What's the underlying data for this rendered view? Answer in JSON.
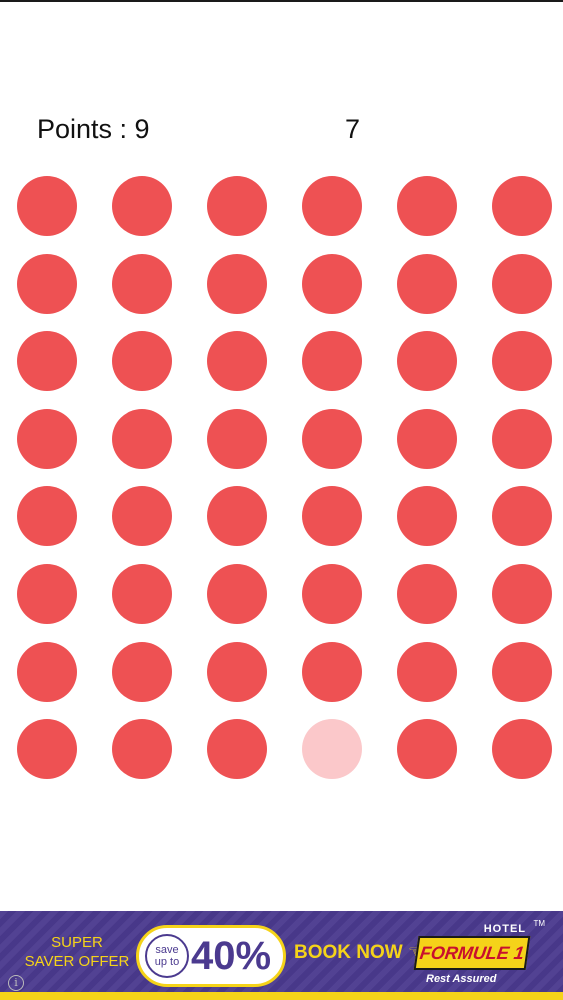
{
  "header": {
    "points_label": "Points : 9",
    "timer_value": "7"
  },
  "board": {
    "columns": 6,
    "rows": 8,
    "active_color": "#ee5153",
    "faded_color": "#fbc8ca",
    "faded_cell": {
      "row": 8,
      "column": 4
    }
  },
  "ad": {
    "super_text": "SUPER\nSAVER OFFER",
    "save_text": "save",
    "upto_text": "up to",
    "discount": "40%",
    "book_now": "BOOK NOW",
    "hotel": "HOTEL",
    "brand": "FORMULE 1",
    "tagline": "Rest Assured",
    "tm": "TM",
    "info_icon": "info-icon",
    "accent_color": "#f5d319",
    "background_color": "#4b3a8f"
  }
}
